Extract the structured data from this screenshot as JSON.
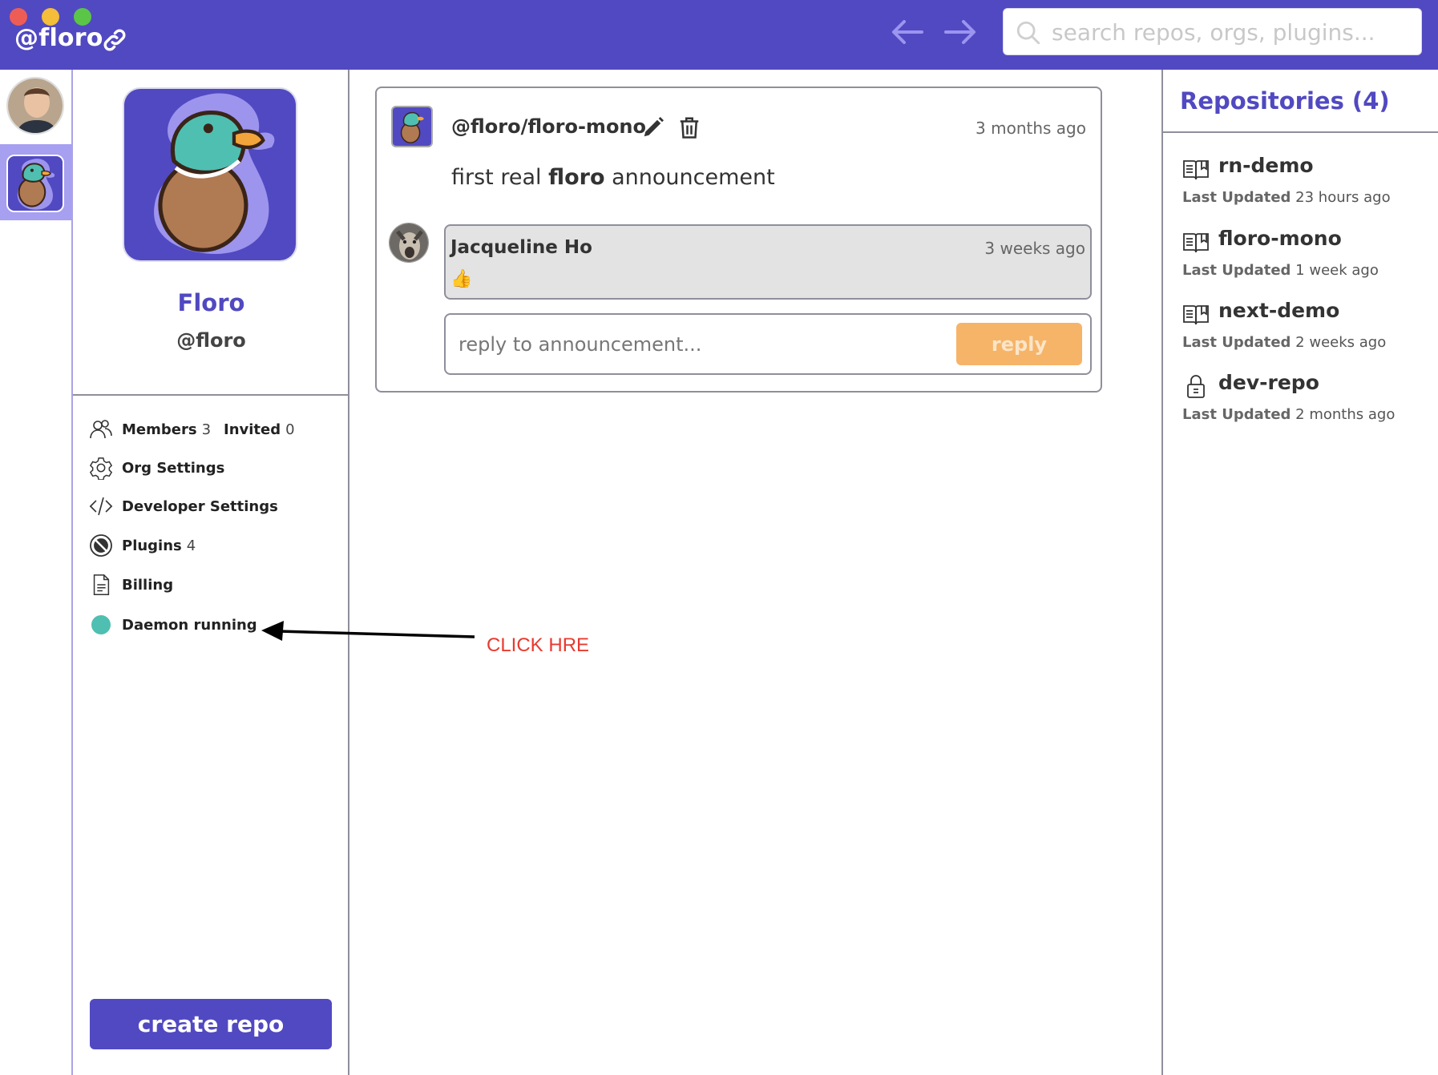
{
  "header": {
    "handle": "@floro",
    "search_placeholder": "search repos, orgs, plugins..."
  },
  "org": {
    "name": "Floro",
    "handle": "@floro"
  },
  "menu": {
    "members_label": "Members",
    "members_count": "3",
    "invited_label": "Invited",
    "invited_count": "0",
    "org_settings": "Org Settings",
    "developer_settings": "Developer Settings",
    "plugins_label": "Plugins",
    "plugins_count": "4",
    "billing": "Billing",
    "daemon_status": "Daemon running"
  },
  "create_repo_label": "create repo",
  "announcement": {
    "repo_handle": "@floro/floro-mono",
    "time": "3 months ago",
    "body_pre": "first real ",
    "body_bold": "floro",
    "body_post": " announcement",
    "reply": {
      "author": "Jacqueline Ho",
      "time": "3 weeks ago",
      "body": "👍"
    },
    "reply_placeholder": "reply to announcement...",
    "reply_button": "reply"
  },
  "annotation": {
    "text": "CLICK HRE"
  },
  "repositories": {
    "heading": "Repositories (4)",
    "meta_label": "Last Updated",
    "items": [
      {
        "name": "rn-demo",
        "updated": "23 hours ago",
        "icon": "book-icon"
      },
      {
        "name": "floro-mono",
        "updated": "1 week ago",
        "icon": "book-icon"
      },
      {
        "name": "next-demo",
        "updated": "2 weeks ago",
        "icon": "book-icon"
      },
      {
        "name": "dev-repo",
        "updated": "2 months ago",
        "icon": "lock-icon"
      }
    ]
  },
  "colors": {
    "brand": "#5149c1",
    "accent_orange": "#f6b468",
    "status_teal": "#4fbfb2",
    "annotation_red": "#e83a2f"
  }
}
